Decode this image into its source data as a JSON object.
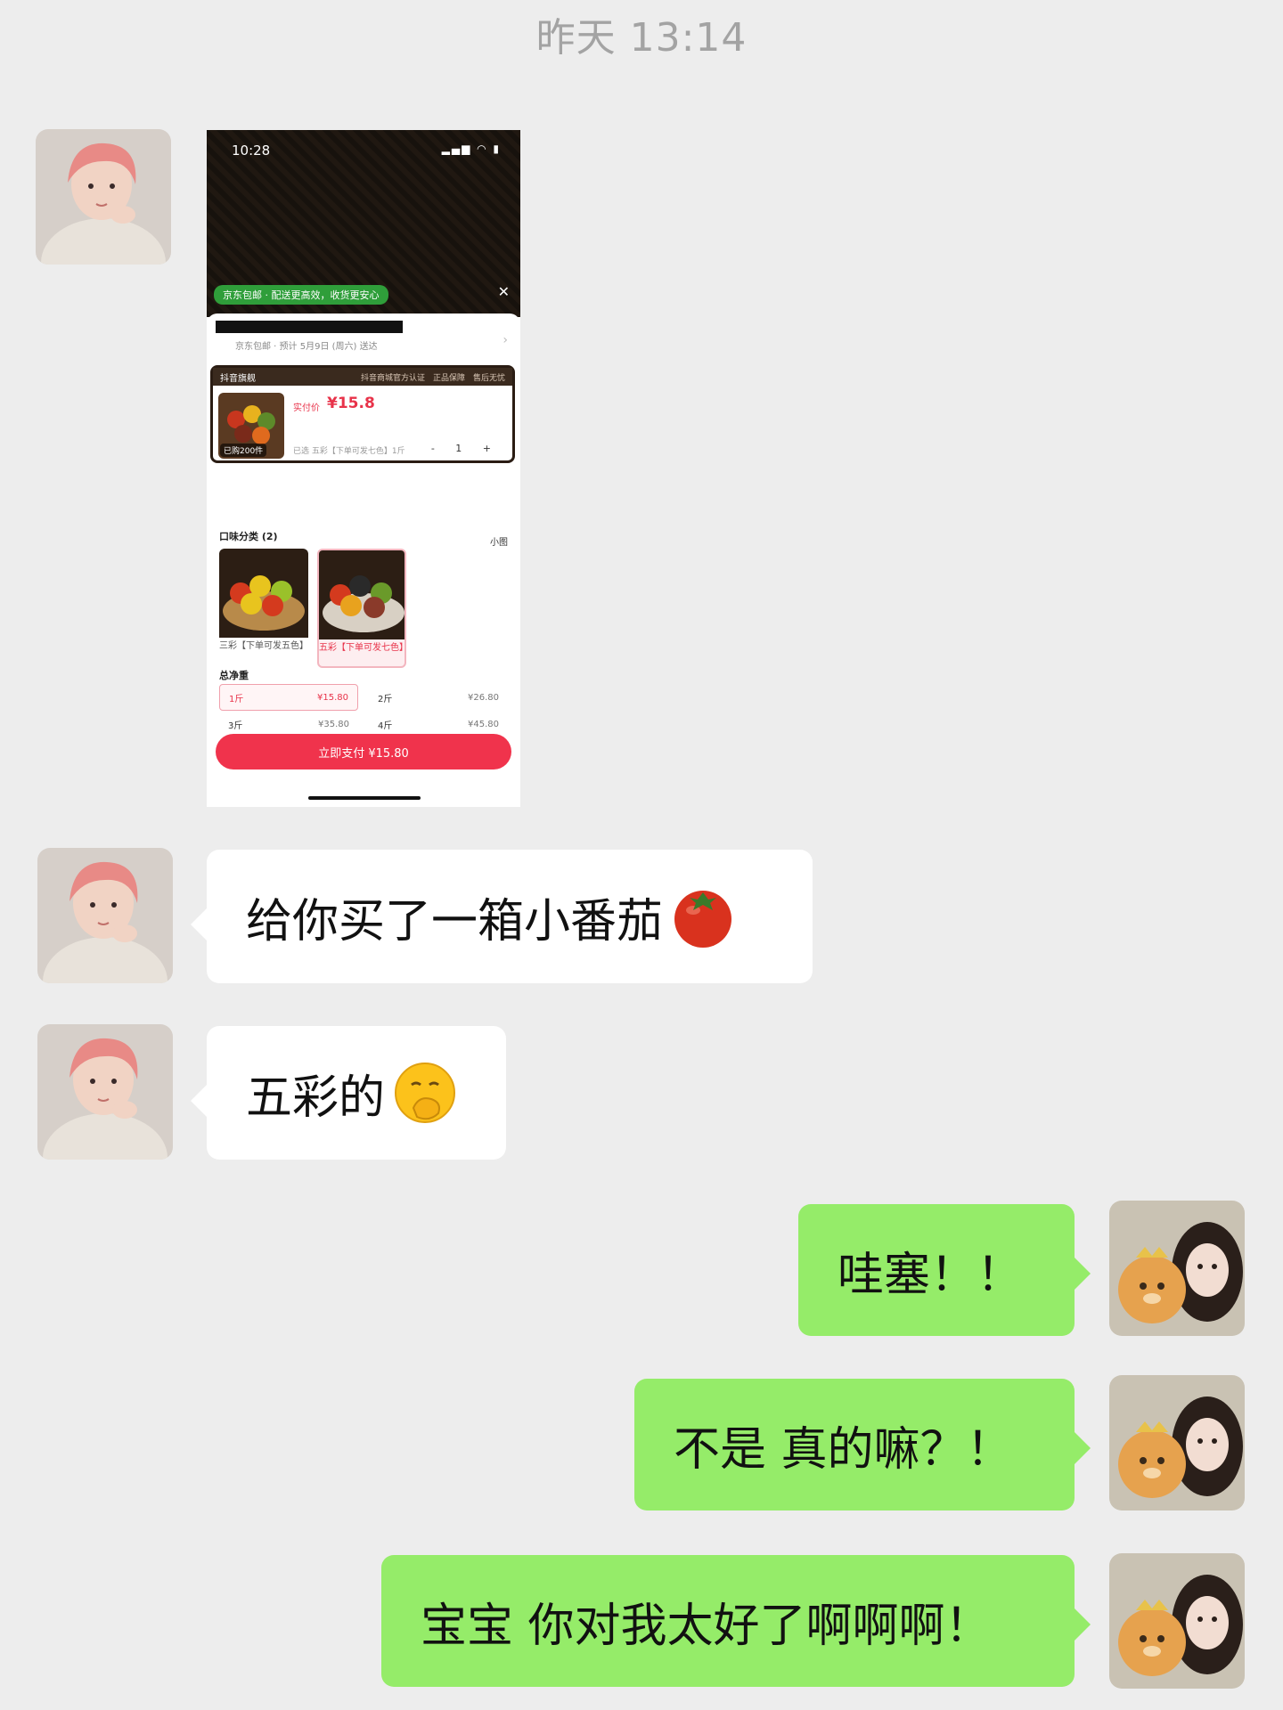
{
  "timestamp": "昨天 13:14",
  "screenshot": {
    "status_time": "10:28",
    "status_icons": "▂▄▆ ◠ ▮",
    "jd_banner": "京东包邮 · 配送更高效，收货更安心",
    "close": "✕",
    "deliver_text": "京东包邮 · 预计 5月9日 (周六) 送达",
    "store_name": "抖音旗舰",
    "store_tags": "抖音商城官方认证　正品保障　售后无忧",
    "pay_label": "实付价",
    "pay_price": "¥15.8",
    "sold_count": "已购200件",
    "selected_text": "已选 五彩【下单可发七色】1斤",
    "qty_controls": "- 1 +",
    "flavor_label": "口味分类 (2)",
    "small_img_label": "小图",
    "options": [
      {
        "label": "三彩【下单可发五色】"
      },
      {
        "label": "五彩【下单可发七色】"
      }
    ],
    "weight_label": "总净重",
    "weights": [
      {
        "name": "1斤",
        "price": "¥15.80"
      },
      {
        "name": "2斤",
        "price": "¥26.80"
      },
      {
        "name": "3斤",
        "price": "¥35.80"
      },
      {
        "name": "4斤",
        "price": "¥45.80"
      }
    ],
    "pay_button": "立即支付 ¥15.80"
  },
  "messages": [
    {
      "side": "in",
      "text": "给你买了一箱小番茄",
      "emoji": "tomato-emoji"
    },
    {
      "side": "in",
      "text": "五彩的",
      "emoji": "face-with-hand-over-mouth-emoji"
    },
    {
      "side": "out",
      "text": "哇塞！！"
    },
    {
      "side": "out",
      "text": "不是 真的嘛？！"
    },
    {
      "side": "out",
      "text": "宝宝 你对我太好了啊啊啊！"
    }
  ],
  "colors": {
    "background": "#ededed",
    "incoming_bubble": "#ffffff",
    "outgoing_bubble": "#95ec69",
    "timestamp_text": "#a3a3a3",
    "accent_red": "#e8334a"
  }
}
